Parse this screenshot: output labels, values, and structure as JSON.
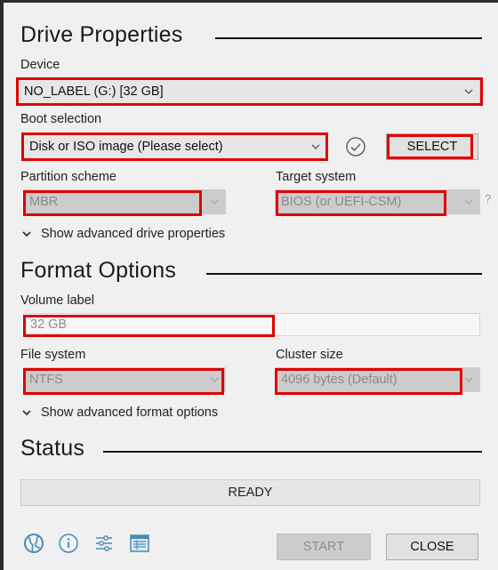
{
  "drive_properties": {
    "title": "Drive Properties",
    "device": {
      "label": "Device",
      "value": "NO_LABEL (G:) [32 GB]"
    },
    "boot_selection": {
      "label": "Boot selection",
      "value": "Disk or ISO image (Please select)",
      "select_button": "SELECT"
    },
    "partition_scheme": {
      "label": "Partition scheme",
      "value": "MBR"
    },
    "target_system": {
      "label": "Target system",
      "value": "BIOS (or UEFI-CSM)",
      "help": "?"
    },
    "advanced_toggle": "Show advanced drive properties"
  },
  "format_options": {
    "title": "Format Options",
    "volume_label": {
      "label": "Volume label",
      "value": "32 GB"
    },
    "file_system": {
      "label": "File system",
      "value": "NTFS"
    },
    "cluster_size": {
      "label": "Cluster size",
      "value": "4096 bytes (Default)"
    },
    "advanced_toggle": "Show advanced format options"
  },
  "status": {
    "title": "Status",
    "text": "READY"
  },
  "footer": {
    "icons": [
      "globe-icon",
      "info-icon",
      "settings-sliders-icon",
      "log-icon"
    ],
    "start_label": "START",
    "close_label": "CLOSE"
  },
  "colors": {
    "highlight": "#e00000",
    "icon": "#4a8ab5"
  }
}
